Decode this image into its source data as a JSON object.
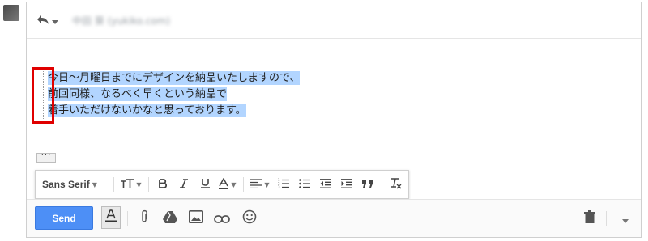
{
  "header": {
    "recipient": "中田 葵 (yukiko.com)"
  },
  "message": {
    "lines": [
      "今日〜月曜日までにデザインを納品いたしますので、",
      "前回同様、なるべく早くという納品で",
      "着手いただけないかなと思っております。"
    ]
  },
  "formatting": {
    "font_label": "Sans Serif",
    "icons": [
      "font-size-icon",
      "bold-icon",
      "italic-icon",
      "underline-icon",
      "text-color-icon",
      "align-icon",
      "numbered-list-icon",
      "bulleted-list-icon",
      "indent-less-icon",
      "indent-more-icon",
      "quote-icon",
      "remove-formatting-icon"
    ]
  },
  "toolbar": {
    "send_label": "Send"
  },
  "colors": {
    "send": "#4d8ff6",
    "highlight": "#b2d5ff",
    "annotation": "#e00000"
  }
}
